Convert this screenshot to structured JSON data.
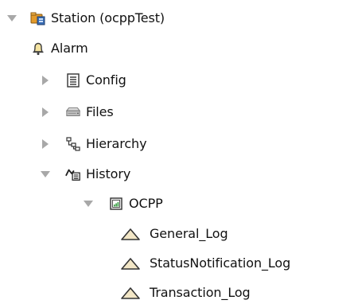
{
  "tree": {
    "station": {
      "label": "Station (ocppTest)",
      "expanded": true,
      "icon": "station-folder-icon"
    },
    "alarm": {
      "label": "Alarm",
      "icon": "bell-icon"
    },
    "config": {
      "label": "Config",
      "expanded": false,
      "icon": "config-icon"
    },
    "files": {
      "label": "Files",
      "expanded": false,
      "icon": "drive-icon"
    },
    "hierarchy": {
      "label": "Hierarchy",
      "expanded": false,
      "icon": "hierarchy-icon"
    },
    "history": {
      "label": "History",
      "expanded": true,
      "icon": "history-icon"
    },
    "ocpp": {
      "label": "OCPP",
      "expanded": true,
      "icon": "device-icon"
    },
    "logs": [
      {
        "label": "General_Log",
        "icon": "log-triangle-icon"
      },
      {
        "label": "StatusNotification_Log",
        "icon": "log-triangle-icon"
      },
      {
        "label": "Transaction_Log",
        "icon": "log-triangle-icon"
      }
    ]
  },
  "colors": {
    "expander": "#a8a8a8",
    "text": "#111111",
    "station_accent": "#e39a2b"
  }
}
